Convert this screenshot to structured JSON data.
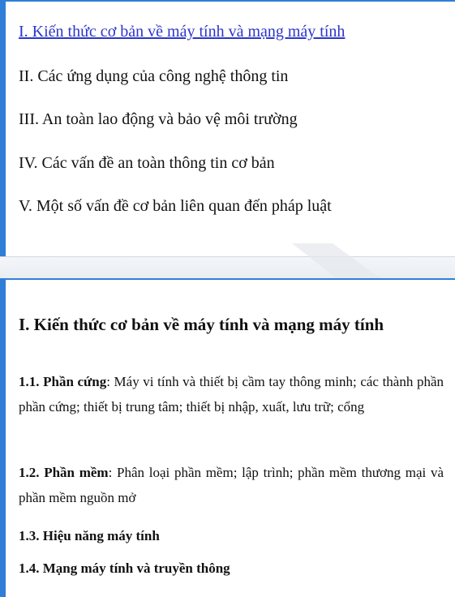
{
  "toc": {
    "items": [
      "I. Kiến thức cơ bản về máy tính và mạng máy tính",
      "II. Các ứng dụng của công nghệ thông tin",
      "III. An toàn lao động và bảo vệ môi trường",
      "IV. Các vấn đề an toàn thông tin cơ bản",
      "V. Một số vấn đề cơ bản liên quan đến pháp luật"
    ]
  },
  "section": {
    "heading": "I. Kiến thức cơ bản về máy tính và mạng máy tính",
    "items": [
      {
        "label": "1.1. Phần cứng",
        "text": ": Máy vi tính và thiết bị cầm tay thông minh; các thành phần phần cứng; thiết bị trung tâm; thiết bị nhập, xuất, lưu trữ; cổng"
      },
      {
        "label": "1.2. Phần mềm",
        "text": ": Phân loại phần mềm; lập trình; phần mềm thương mại và phần mềm nguồn mở"
      },
      {
        "label": "1.3. Hiệu năng máy tính",
        "text": ""
      },
      {
        "label": "1.4. Mạng máy tính và truyền thông",
        "text": ""
      }
    ]
  },
  "colors": {
    "accent": "#2f7fd8",
    "link": "#2b35c9"
  }
}
